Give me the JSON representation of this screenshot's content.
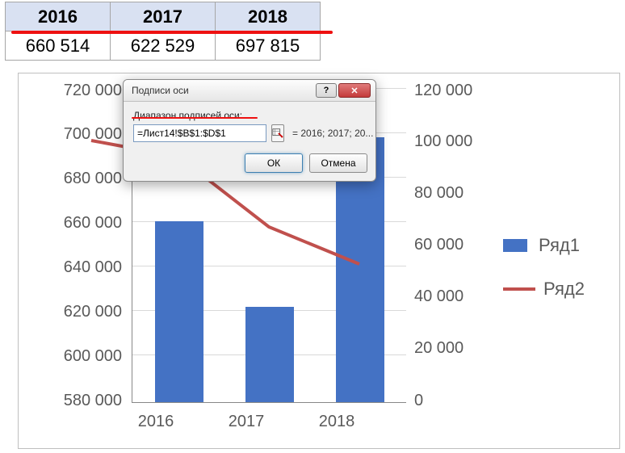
{
  "sheet": {
    "headers": [
      "2016",
      "2017",
      "2018"
    ],
    "row": [
      "660 514",
      "622 529",
      "697 815"
    ]
  },
  "chart_data": {
    "type": "bar",
    "categories": [
      "2016",
      "2017",
      "2018"
    ],
    "series": [
      {
        "name": "Ряд1",
        "type": "bar",
        "axis": "left",
        "values": [
          660514,
          622529,
          697815
        ]
      },
      {
        "name": "Ряд2",
        "type": "line",
        "axis": "right",
        "values": [
          null,
          67000,
          53000
        ]
      }
    ],
    "y_left": {
      "min": 580000,
      "max": 720000,
      "step": 20000,
      "ticks": [
        "580 000",
        "600 000",
        "620 000",
        "640 000",
        "660 000",
        "680 000",
        "700 000",
        "720 000"
      ]
    },
    "y_right": {
      "min": 0,
      "max": 120000,
      "step": 20000,
      "ticks": [
        "0",
        "20 000",
        "40 000",
        "60 000",
        "80 000",
        "100 000",
        "120 000"
      ]
    },
    "colors": {
      "bar": "#4472c4",
      "line": "#c0504d"
    },
    "legend_position": "right"
  },
  "legend": {
    "s1": "Ряд1",
    "s2": "Ряд2"
  },
  "dialog": {
    "title": "Подписи оси",
    "field_label": "Диапазон подписей оси:",
    "value": "=Лист14!$B$1:$D$1",
    "preview": "= 2016; 2017; 20...",
    "ok": "ОК",
    "cancel": "Отмена",
    "help_glyph": "?",
    "close_glyph": "✕"
  }
}
